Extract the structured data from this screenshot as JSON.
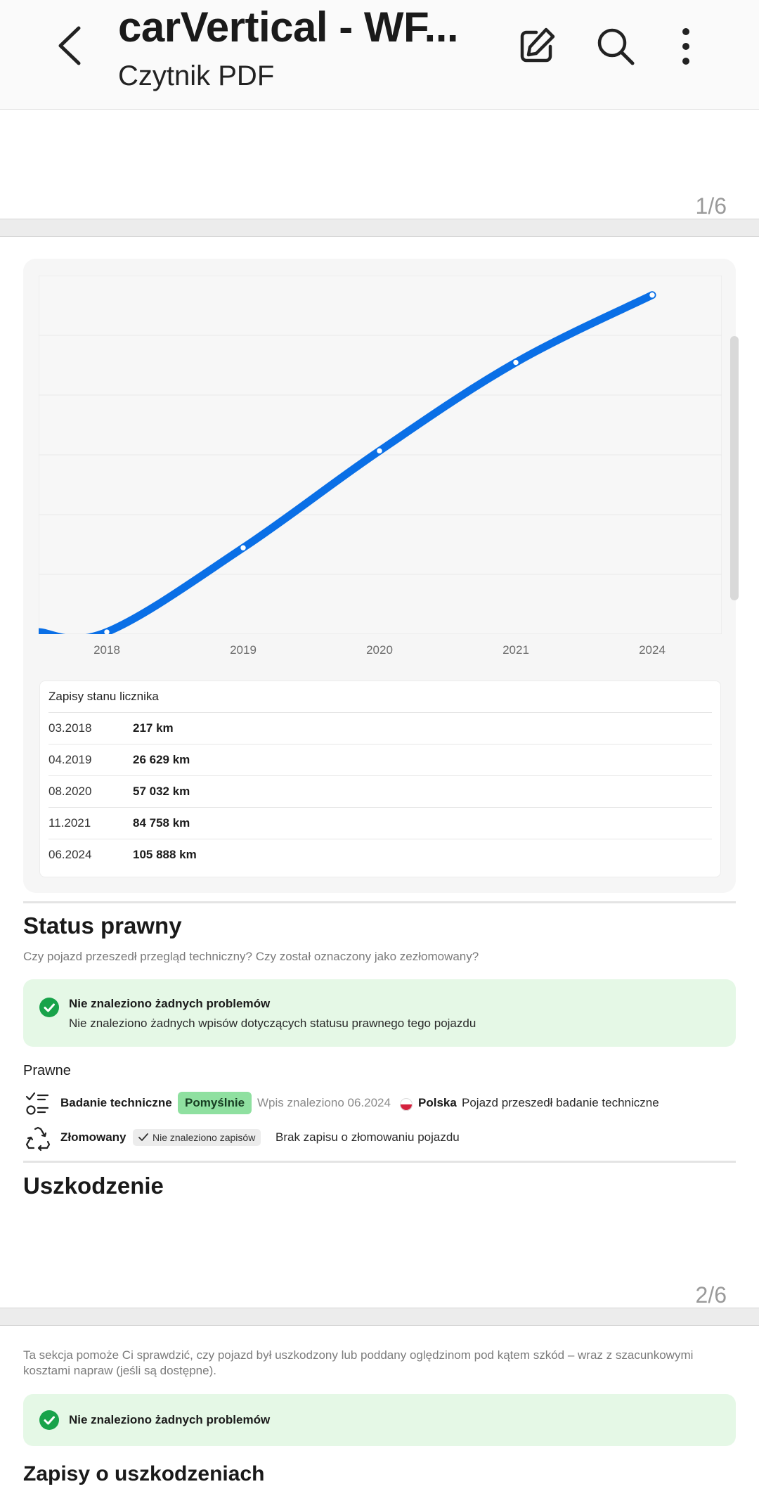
{
  "header": {
    "title": "carVertical - WF...",
    "subtitle": "Czytnik PDF"
  },
  "pages": {
    "first_indicator": "1/6",
    "second_indicator": "2/6"
  },
  "chart_data": {
    "type": "line",
    "title": "",
    "categories": [
      "2018",
      "2019",
      "2020",
      "2021",
      "2024"
    ],
    "series": [
      {
        "values": [
          217,
          26629,
          57032,
          84758,
          105888
        ]
      }
    ],
    "ylim": [
      0,
      112000
    ],
    "grid": true,
    "color": "#0a6fe6"
  },
  "odometer": {
    "header": "Zapisy stanu licznika",
    "rows": [
      {
        "date": "03.2018",
        "value": "217 km"
      },
      {
        "date": "04.2019",
        "value": "26 629 km"
      },
      {
        "date": "08.2020",
        "value": "57 032 km"
      },
      {
        "date": "11.2021",
        "value": "84 758 km"
      },
      {
        "date": "06.2024",
        "value": "105 888 km"
      }
    ]
  },
  "legal": {
    "heading": "Status prawny",
    "question": "Czy pojazd przeszedł przegląd techniczny? Czy został oznaczony jako zezłomowany?",
    "ok_title": "Nie znaleziono żadnych problemów",
    "ok_text": "Nie znaleziono żadnych wpisów dotyczących statusu prawnego tego pojazdu",
    "subheading": "Prawne",
    "inspection": {
      "label": "Badanie techniczne",
      "badge": "Pomyślnie",
      "found": "Wpis znaleziono 06.2024",
      "country": "Polska",
      "note": "Pojazd przeszedł badanie techniczne"
    },
    "scrapped": {
      "label": "Złomowany",
      "badge": "Nie znaleziono zapisów",
      "note": "Brak zapisu o złomowaniu pojazdu"
    }
  },
  "damage": {
    "heading": "Uszkodzenie",
    "description": "Ta sekcja pomoże Ci sprawdzić, czy pojazd był uszkodzony lub poddany oględzinom pod kątem szkód – wraz z szacunkowymi kosztami napraw (jeśli są dostępne).",
    "ok_title": "Nie znaleziono żadnych problemów",
    "records_heading": "Zapisy o uszkodzeniach"
  },
  "colors": {
    "accent": "#0a6fe6",
    "success": "#18a34a",
    "success_bg": "#e5f8e6"
  }
}
